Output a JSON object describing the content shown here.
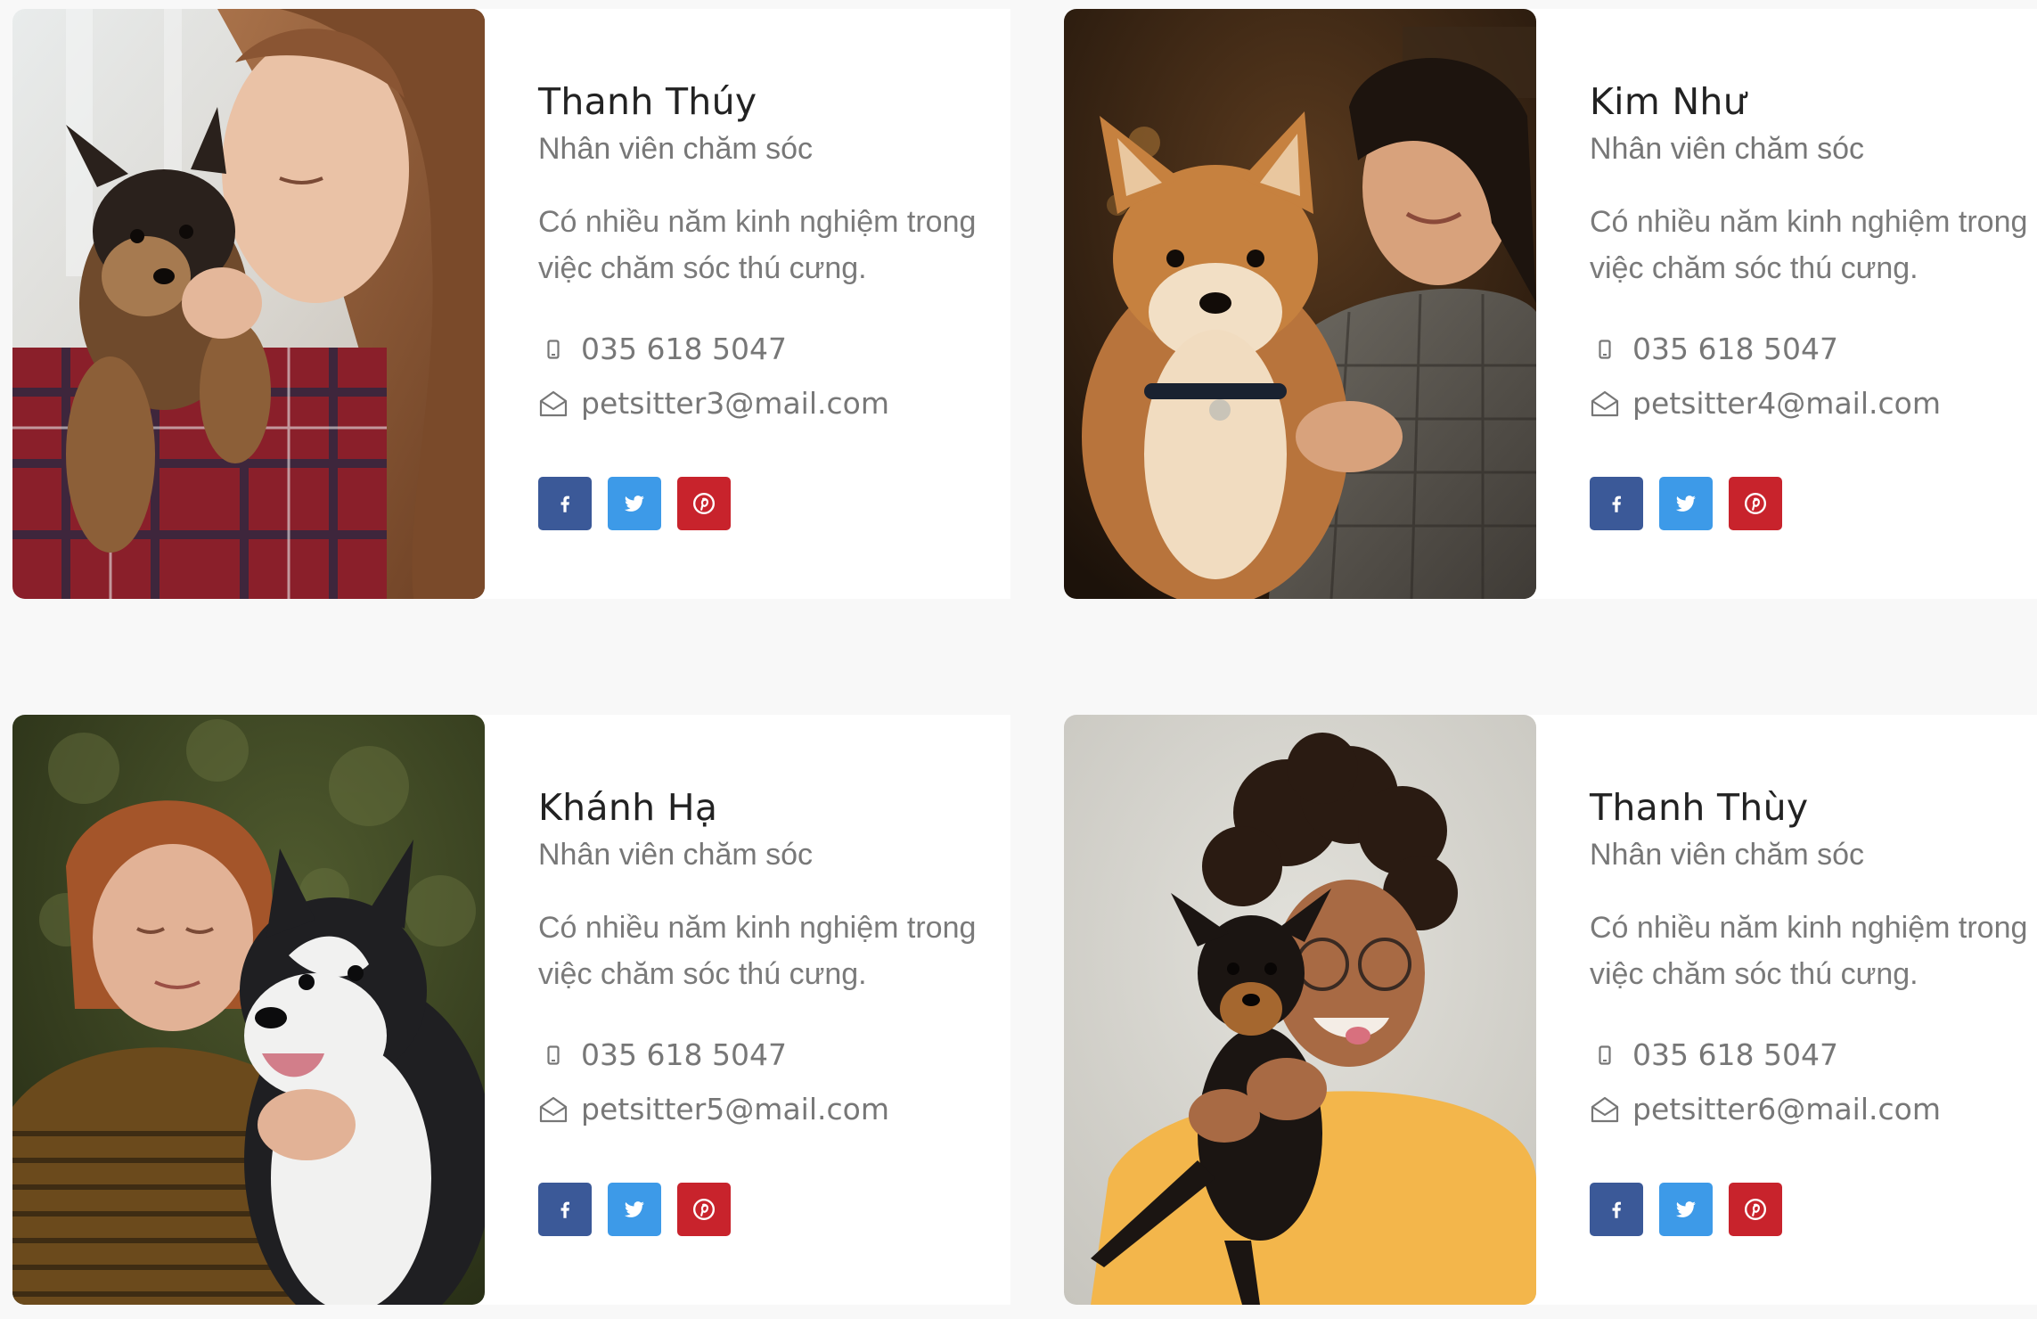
{
  "colors": {
    "facebook": "#3b5998",
    "twitter": "#3d9ae8",
    "pinterest": "#c8232c",
    "page_background": "#f8f8f8",
    "card_background": "#ffffff"
  },
  "members": [
    {
      "name": "Thanh Thúy",
      "role": "Nhân viên chăm sóc",
      "description": "Có nhiều năm kinh nghiệm trong việc chăm sóc thú cưng.",
      "phone": "035 618 5047",
      "email": "petsitter3@mail.com",
      "photo": "woman-kissing-yorkie-puppy"
    },
    {
      "name": "Kim Như",
      "role": "Nhân viên chăm sóc",
      "description": "Có nhiều năm kinh nghiệm trong việc chăm sóc thú cưng.",
      "phone": "035 618 5047",
      "email": "petsitter4@mail.com",
      "photo": "woman-holding-shiba-inu"
    },
    {
      "name": "Khánh Hạ",
      "role": "Nhân viên chăm sóc",
      "description": "Có nhiều năm kinh nghiệm trong việc chăm sóc thú cưng.",
      "phone": "035 618 5047",
      "email": "petsitter5@mail.com",
      "photo": "woman-hugging-husky"
    },
    {
      "name": "Thanh Thùy",
      "role": "Nhân viên chăm sóc",
      "description": "Có nhiều năm kinh nghiệm trong việc chăm sóc thú cưng.",
      "phone": "035 618 5047",
      "email": "petsitter6@mail.com",
      "photo": "woman-holding-pinscher-puppy"
    }
  ],
  "icons": {
    "phone": "mobile-phone-icon",
    "email": "open-envelope-icon",
    "social": [
      "facebook-icon",
      "twitter-icon",
      "pinterest-icon"
    ]
  }
}
